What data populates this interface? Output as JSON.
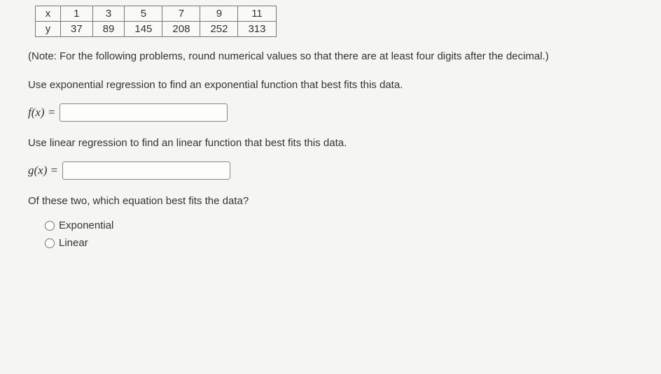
{
  "chart_data": {
    "type": "table",
    "rows": [
      {
        "header": "x",
        "values": [
          "1",
          "3",
          "5",
          "7",
          "9",
          "11"
        ]
      },
      {
        "header": "y",
        "values": [
          "37",
          "89",
          "145",
          "208",
          "252",
          "313"
        ]
      }
    ]
  },
  "note": "(Note: For the following problems, round numerical values so that there are at least four digits after the decimal.)",
  "prompt1": "Use exponential regression to find an exponential function that best fits this data.",
  "fx_label": "f(x) =",
  "fx_value": "",
  "prompt2": "Use linear regression to find an linear function that best fits this data.",
  "gx_label": "g(x) =",
  "gx_value": "",
  "prompt3": "Of these two, which equation best fits the data?",
  "options": {
    "exponential": "Exponential",
    "linear": "Linear"
  }
}
